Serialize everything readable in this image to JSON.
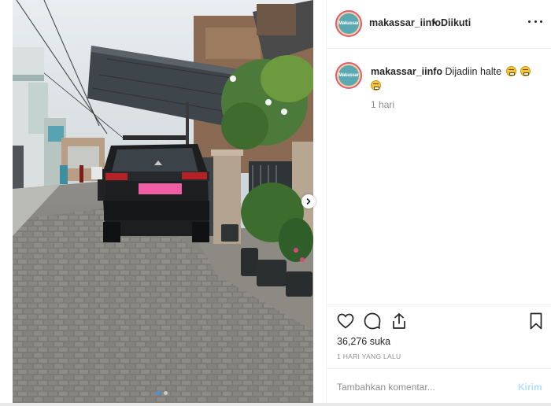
{
  "header": {
    "avatar_text": "Makassar",
    "username": "makassar_iinfo",
    "separator": "•",
    "follow_status": "Diikuti",
    "more_icon": "more-horizontal-icon"
  },
  "caption": {
    "username": "makassar_iinfo",
    "text": "Dijadiin halte",
    "emojis": [
      "grinning-sweat-emoji",
      "grinning-sweat-emoji",
      "grinning-sweat-emoji"
    ],
    "time_ago": "1 hari"
  },
  "actions": {
    "like_icon": "heart-icon",
    "comment_icon": "comment-icon",
    "share_icon": "share-icon",
    "save_icon": "bookmark-icon"
  },
  "likes_text": "36,276 suka",
  "date_text": "1 HARI YANG LALU",
  "comment_box": {
    "placeholder": "Tambahkan komentar...",
    "send_label": "Kirim"
  },
  "carousel": {
    "total_slides": 2,
    "current_slide": 1,
    "next_icon": "chevron-right-icon"
  },
  "colors": {
    "link_blue": "#3897f0",
    "send_disabled": "#b2dffc",
    "muted_text": "#8e8e8e",
    "border": "#efefef"
  }
}
